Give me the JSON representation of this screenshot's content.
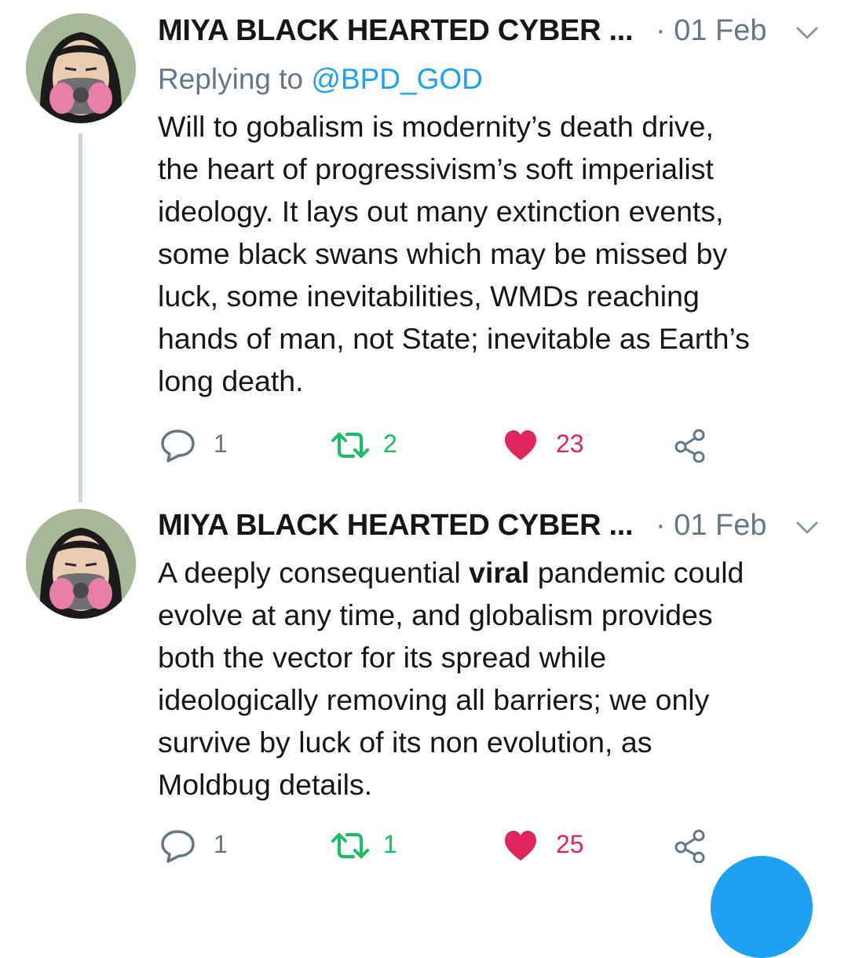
{
  "colors": {
    "text": "#14171a",
    "secondary": "#657786",
    "link": "#1da1f2",
    "retweet": "#17bf63",
    "like": "#e0245e",
    "thread_line": "#ccd6dd"
  },
  "tweets": [
    {
      "author_name": "MIYA BLACK HEARTED CYBER ...",
      "separator": "·",
      "date": "01 Feb",
      "replying_to_label": "Replying to",
      "replying_to_handle": "@BPD_GOD",
      "text_lines": [
        "Will to gobalism is modernity’s death drive,",
        "the heart of progressivism’s soft imperialist",
        "ideology. It lays out many extinction events,",
        "some black swans which may be missed by",
        "luck, some inevitabilities, WMDs reaching",
        "hands of man, not State; inevitable as Earth’s",
        "long death."
      ],
      "reply_count": "1",
      "retweet_count": "2",
      "like_count": "23",
      "liked": true
    },
    {
      "author_name": "MIYA BLACK HEARTED CYBER ...",
      "separator": "·",
      "date": "01 Feb",
      "text_line1_pre": "A deeply consequential ",
      "text_line1_bold": "viral",
      "text_line1_post": " pandemic could",
      "text_lines": [
        "evolve at any time, and globalism provides",
        "both the vector for its spread while",
        "ideologically removing all barriers; we only",
        "survive by luck of its non evolution, as",
        "Moldbug details."
      ],
      "reply_count": "1",
      "retweet_count": "1",
      "like_count": "25",
      "liked": true
    }
  ],
  "icons": {
    "reply": "reply-icon",
    "retweet": "retweet-icon",
    "like": "heart-icon",
    "share": "share-icon",
    "menu": "chevron-down-icon",
    "compose": "compose-fab"
  }
}
